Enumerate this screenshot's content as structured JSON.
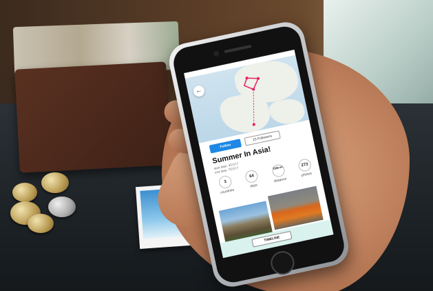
{
  "app": {
    "title": "Summer In Asia!",
    "start_date": "start date: 4/21/17",
    "end_date": "end date: 7/21/17",
    "follow_label": "Follow",
    "followers_label": "15 Followers",
    "timeline_label": "TIMELINE",
    "back_icon": "arrow-left-icon",
    "stats": [
      {
        "value": "3",
        "label": "countries"
      },
      {
        "value": "64",
        "label": "days"
      },
      {
        "value": "7388 mi",
        "label": "distance"
      },
      {
        "value": "273",
        "label": "photos"
      }
    ],
    "accent_color": "#1e88e5"
  }
}
